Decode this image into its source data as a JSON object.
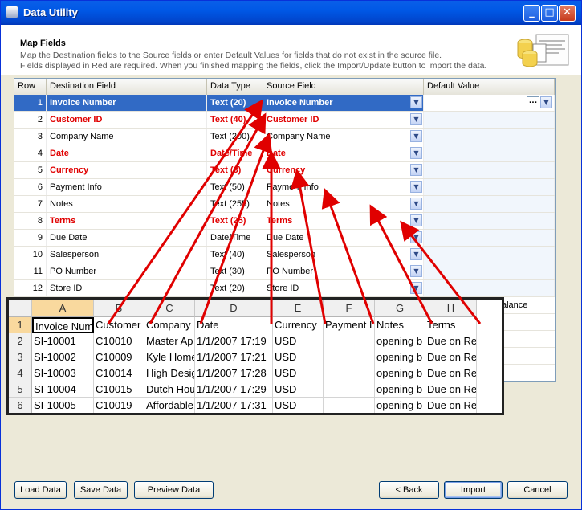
{
  "window": {
    "title": "Data Utility"
  },
  "header": {
    "title": "Map Fields",
    "description_line1": "Map the Destination fields to the Source fields or enter Default Values for fields that do not exist in the source file.",
    "description_line2": "Fields displayed in Red are required.  When you finished mapping the fields, click the Import/Update button to import the data."
  },
  "grid": {
    "columns": [
      "Row",
      "Destination Field",
      "Data Type",
      "Source Field",
      "Default Value"
    ],
    "rows": [
      {
        "row": "1",
        "dest": "Invoice Number",
        "type": "Text (20)",
        "source": "Invoice Number",
        "required": true,
        "selected": true
      },
      {
        "row": "2",
        "dest": "Customer ID",
        "type": "Text (40)",
        "source": "Customer ID",
        "required": true
      },
      {
        "row": "3",
        "dest": "Company Name",
        "type": "Text (200)",
        "source": "Company Name",
        "required": false
      },
      {
        "row": "4",
        "dest": "Date",
        "type": "Date/Time",
        "source": "Date",
        "required": true
      },
      {
        "row": "5",
        "dest": "Currency",
        "type": "Text (3)",
        "source": "Currency",
        "required": true
      },
      {
        "row": "6",
        "dest": "Payment Info",
        "type": "Text (50)",
        "source": "Payment Info",
        "required": false
      },
      {
        "row": "7",
        "dest": "Notes",
        "type": "Text (255)",
        "source": "Notes",
        "required": false
      },
      {
        "row": "8",
        "dest": "Terms",
        "type": "Text (25)",
        "source": "Terms",
        "required": true
      },
      {
        "row": "9",
        "dest": "Due Date",
        "type": "Date/Time",
        "source": "Due Date",
        "required": false
      },
      {
        "row": "10",
        "dest": "Salesperson",
        "type": "Text (40)",
        "source": "Salesperson",
        "required": false
      },
      {
        "row": "11",
        "dest": "PO Number",
        "type": "Text (30)",
        "source": "PO Number",
        "required": false
      },
      {
        "row": "12",
        "dest": "Store ID",
        "type": "Text (20)",
        "source": "Store ID",
        "required": false
      }
    ],
    "partial_text": "alance"
  },
  "spreadsheet": {
    "columns": [
      "A",
      "B",
      "C",
      "D",
      "E",
      "F",
      "G",
      "H"
    ],
    "rows": [
      {
        "num": "1",
        "cells": [
          "Invoice Number",
          "Customer",
          "Company",
          "Date",
          "Currency",
          "Payment I",
          "Notes",
          "Terms"
        ]
      },
      {
        "num": "2",
        "cells": [
          "SI-10001",
          "C10010",
          "Master Ap",
          "1/1/2007 17:19",
          "USD",
          "",
          "opening b",
          "Due on Re"
        ]
      },
      {
        "num": "3",
        "cells": [
          "SI-10002",
          "C10009",
          "Kyle Home",
          "1/1/2007 17:21",
          "USD",
          "",
          "opening b",
          "Due on Re"
        ]
      },
      {
        "num": "4",
        "cells": [
          "SI-10003",
          "C10014",
          "High Desig",
          "1/1/2007 17:28",
          "USD",
          "",
          "opening b",
          "Due on Re"
        ]
      },
      {
        "num": "5",
        "cells": [
          "SI-10004",
          "C10015",
          "Dutch Hou",
          "1/1/2007 17:29",
          "USD",
          "",
          "opening b",
          "Due on Re"
        ]
      },
      {
        "num": "6",
        "cells": [
          "SI-10005",
          "C10019",
          "Affordable",
          "1/1/2007 17:31",
          "USD",
          "",
          "opening b",
          "Due on Re"
        ]
      }
    ]
  },
  "buttons": {
    "load": "Load Data",
    "save": "Save Data",
    "preview": "Preview Data",
    "back": "< Back",
    "import": "Import",
    "cancel": "Cancel"
  },
  "colors": {
    "required": "#e00000",
    "arrow": "#e00000",
    "selection": "#316ac5",
    "titlebar": "#0058e6"
  }
}
